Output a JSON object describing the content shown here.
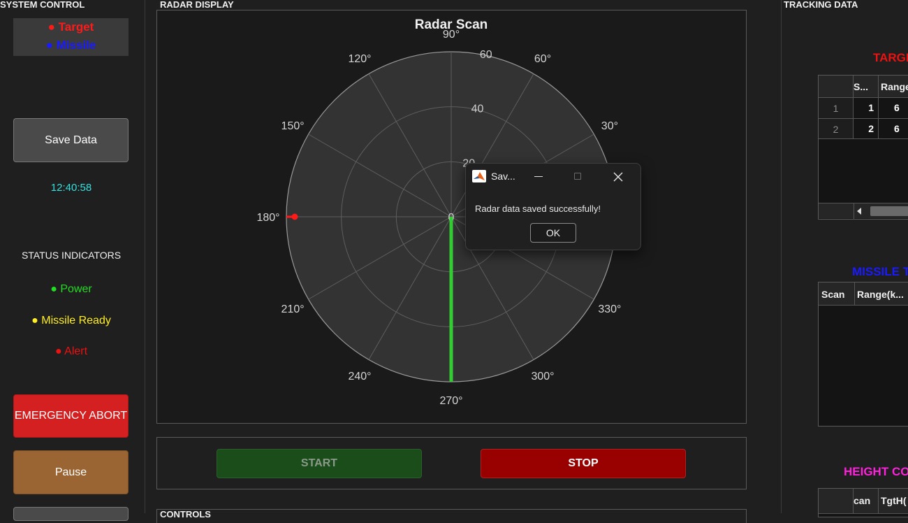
{
  "panels": {
    "system_control": "SYSTEM CONTROL",
    "radar_display": "RADAR DISPLAY",
    "tracking_data": "TRACKING DATA",
    "controls": "CONTROLS"
  },
  "legend": {
    "target": "● Target",
    "missile": "● Missile"
  },
  "sidebar": {
    "save_label": "Save Data",
    "clock": "12:40:58",
    "status_title": "STATUS INDICATORS",
    "power": "● Power",
    "missile_ready": "● Missile Ready",
    "alert": "● Alert",
    "abort_label": "EMERGENCY ABORT",
    "pause_label": "Pause"
  },
  "radar": {
    "title": "Radar Scan",
    "angle_labels": [
      "0",
      "30°",
      "60°",
      "90°",
      "120°",
      "150°",
      "180°",
      "210°",
      "240°",
      "270°",
      "300°",
      "330°"
    ],
    "range_labels": [
      "20",
      "40",
      "60"
    ],
    "center_label": "0",
    "max_range": 60,
    "sweep_angle_deg": 270,
    "target": {
      "angle_deg": 180,
      "range": 60
    }
  },
  "controls": {
    "start_label": "START",
    "stop_label": "STOP"
  },
  "tracking": {
    "target_title": "TARGE",
    "target_table": {
      "headers": [
        "",
        "S...",
        "Range"
      ],
      "rows": [
        [
          "1",
          "1",
          "6"
        ],
        [
          "2",
          "2",
          "6"
        ]
      ]
    },
    "missile_title": "MISSILE T",
    "missile_table": {
      "headers": [
        "Scan",
        "Range(k..."
      ]
    },
    "height_title": "HEIGHT CO",
    "height_table": {
      "headers": [
        "",
        "can",
        "TgtH("
      ]
    }
  },
  "dialog": {
    "title": "Sav...",
    "message": "Radar data saved successfully!",
    "ok_label": "OK"
  },
  "colors": {
    "target": "#ff1a1a",
    "missile": "#1a1aff",
    "clock": "#33e0e0",
    "power": "#22dd22",
    "missile_ready": "#ffee22",
    "alert": "#ee1111",
    "height_title": "#ff22dd",
    "sweep": "#33cc33",
    "abort_bg": "#d42020",
    "pause_bg": "#9a6533",
    "start_bg": "#1b4d1b",
    "stop_bg": "#990000"
  }
}
